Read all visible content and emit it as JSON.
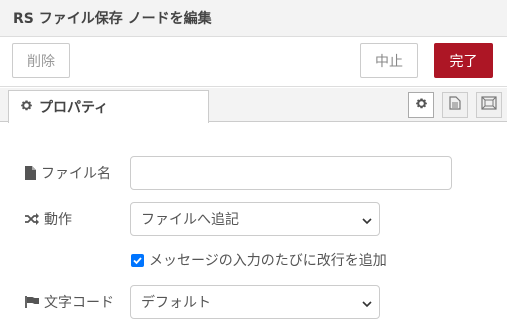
{
  "header": {
    "title": "RS ファイル保存 ノードを編集"
  },
  "toolbar": {
    "delete_label": "削除",
    "cancel_label": "中止",
    "done_label": "完了"
  },
  "tabs": {
    "properties_label": "プロパティ",
    "icons": [
      "gear-icon",
      "document-icon",
      "frame-icon"
    ]
  },
  "form": {
    "filename": {
      "label": "ファイル名",
      "value": "",
      "icon": "file-icon"
    },
    "action": {
      "label": "動作",
      "selected": "ファイルへ追記",
      "icon": "shuffle-icon"
    },
    "newline": {
      "label": "メッセージの入力のたびに改行を追加",
      "checked": true
    },
    "encoding": {
      "label": "文字コード",
      "selected": "デフォルト",
      "icon": "flag-icon"
    }
  },
  "colors": {
    "accent": "#ad1625",
    "checkbox": "#0075ff",
    "header_bg": "#f3f3f3"
  }
}
